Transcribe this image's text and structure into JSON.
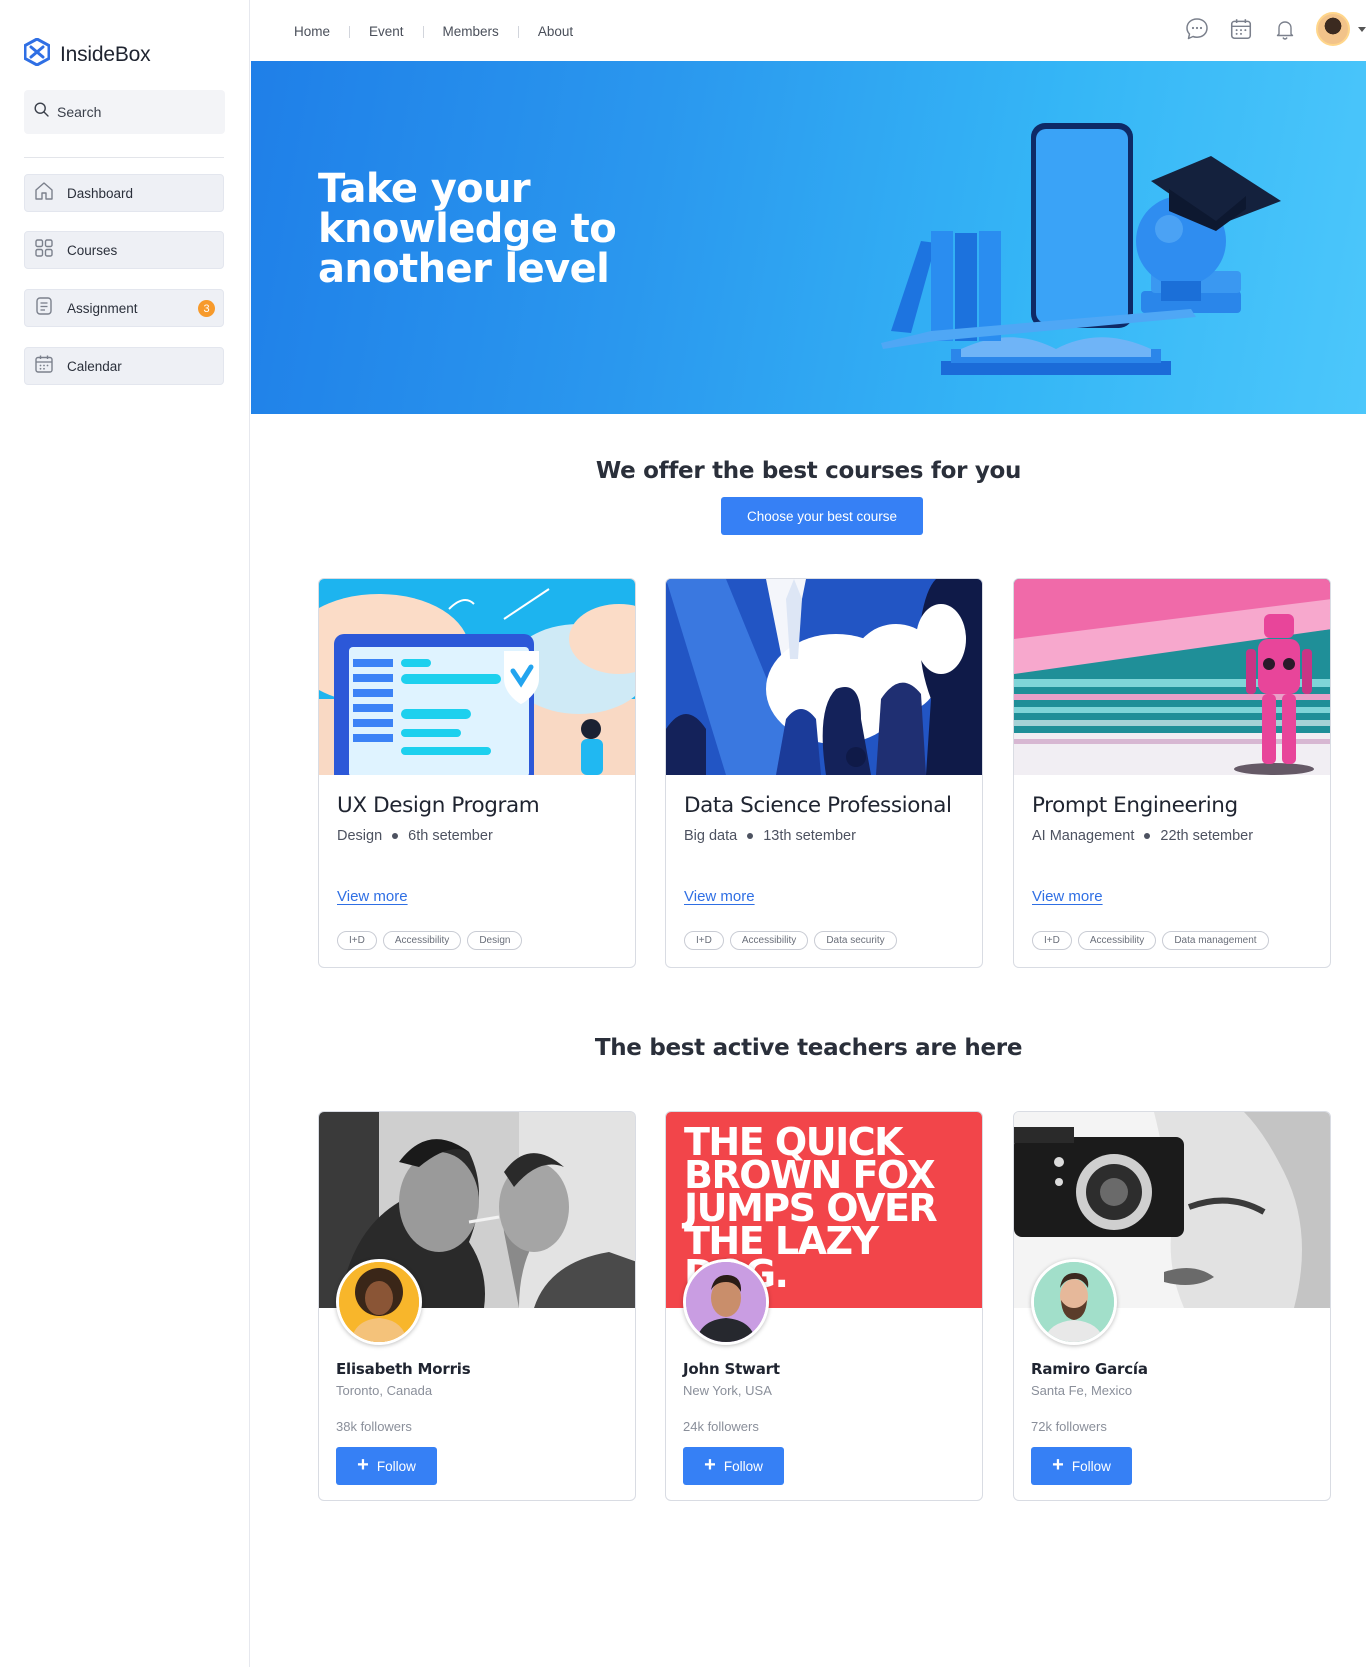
{
  "app": {
    "name": "InsideBox",
    "brand_color": "#3680f5"
  },
  "sidebar": {
    "search_placeholder": "Search",
    "items": [
      {
        "label": "Dashboard",
        "icon": "home-icon"
      },
      {
        "label": "Courses",
        "icon": "grid-icon"
      },
      {
        "label": "Assignment",
        "icon": "document-icon",
        "badge": "3"
      },
      {
        "label": "Calendar",
        "icon": "calendar-icon"
      }
    ]
  },
  "topnav": {
    "links": [
      "Home",
      "Event",
      "Members",
      "About"
    ],
    "icons": [
      "chat-icon",
      "calendar-icon",
      "bell-icon",
      "user-avatar"
    ]
  },
  "hero": {
    "title": "Take your\nknowledge to\nanother level"
  },
  "courses_section": {
    "title": "We offer the best courses for you",
    "cta_label": "Choose your best course",
    "courses": [
      {
        "title": "UX Design Program",
        "category": "Design",
        "date": "6th setember",
        "link": "View more",
        "tags": [
          "I+D",
          "Accessibility",
          "Design"
        ]
      },
      {
        "title": "Data Science Professional",
        "category": "Big data",
        "date": "13th setember",
        "link": "View more",
        "tags": [
          "I+D",
          "Accessibility",
          "Data security"
        ]
      },
      {
        "title": "Prompt Engineering",
        "category": "AI Management",
        "date": "22th setember",
        "link": "View more",
        "tags": [
          "I+D",
          "Accessibility",
          "Data management"
        ]
      }
    ]
  },
  "teachers_section": {
    "title": "The best active teachers are here",
    "cover2_text": "THE QUICK BROWN FOX JUMPS OVER THE LAZY DOG.",
    "teachers": [
      {
        "name": "Elisabeth Morris",
        "location": "Toronto, Canada",
        "followers": "38k followers",
        "follow_label": "Follow"
      },
      {
        "name": "John Stwart",
        "location": "New York, USA",
        "followers": "24k followers",
        "follow_label": "Follow"
      },
      {
        "name": "Ramiro García",
        "location": "Santa Fe, Mexico",
        "followers": "72k followers",
        "follow_label": "Follow"
      }
    ]
  }
}
